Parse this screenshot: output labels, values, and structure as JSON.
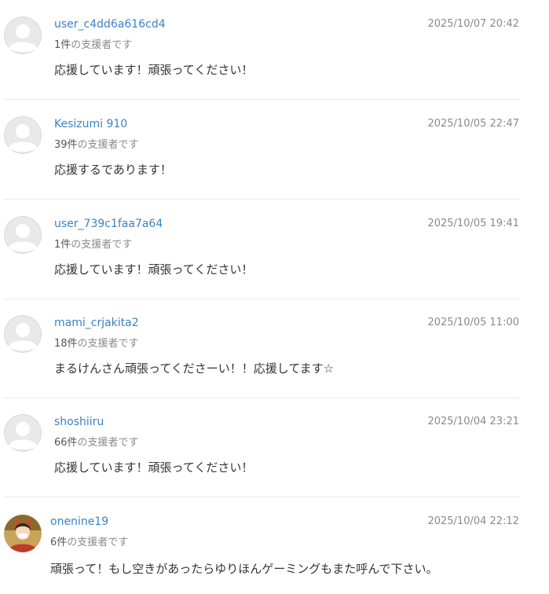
{
  "comments": [
    {
      "username": "user_c4dd6a616cd4",
      "supporter_count": "1件",
      "supporter_suffix": "の支援者です",
      "timestamp": "2025/10/07 20:42",
      "message": "応援しています！頑張ってください！",
      "avatar": "default-avatar-icon"
    },
    {
      "username": "Kesizumi 910",
      "supporter_count": "39件",
      "supporter_suffix": "の支援者です",
      "timestamp": "2025/10/05 22:47",
      "message": "応援するであります！",
      "avatar": "default-avatar-icon"
    },
    {
      "username": "user_739c1faa7a64",
      "supporter_count": "1件",
      "supporter_suffix": "の支援者です",
      "timestamp": "2025/10/05 19:41",
      "message": "応援しています！頑張ってください！",
      "avatar": "default-avatar-icon"
    },
    {
      "username": "mami_crjakita2",
      "supporter_count": "18件",
      "supporter_suffix": "の支援者です",
      "timestamp": "2025/10/05 11:00",
      "message": "まるけんさん頑張ってくださーい！！応援してます☆",
      "avatar": "default-avatar-icon"
    },
    {
      "username": "shoshiiru",
      "supporter_count": "66件",
      "supporter_suffix": "の支援者です",
      "timestamp": "2025/10/04 23:21",
      "message": "応援しています！頑張ってください！",
      "avatar": "default-avatar-icon"
    },
    {
      "username": "onenine19",
      "supporter_count": "6件",
      "supporter_suffix": "の支援者です",
      "timestamp": "2025/10/04 22:12",
      "message": "頑張って！もし空きがあったらゆりほんゲーミングもまた呼んで下さい。",
      "avatar": "user-photo-avatar"
    }
  ],
  "colors": {
    "username_link": "#3b82c4",
    "meta_text": "#8a8a8a",
    "message_text": "#333333",
    "divider": "#ececec",
    "default_avatar_bg": "#e9e9e9",
    "default_avatar_fg": "#ffffff"
  }
}
